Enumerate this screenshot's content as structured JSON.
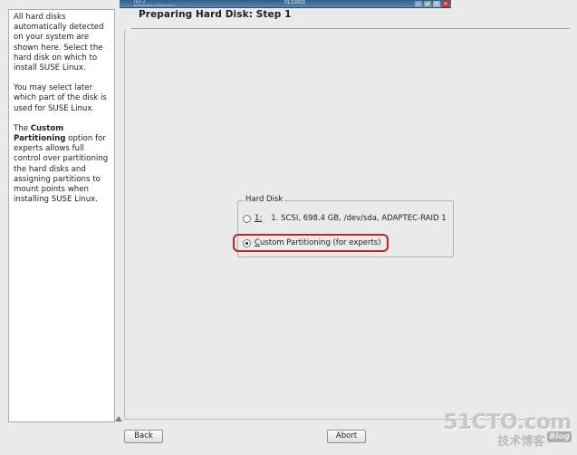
{
  "remote_console": {
    "brand_line": "ILO 2",
    "sub_line": "INTEGRATED LIGHTS-OUT 2",
    "host": "DL320G5",
    "tray_icons": [
      "monitor-icon",
      "network-icon",
      "power-icon",
      "close-icon"
    ]
  },
  "help": {
    "p1": "All hard disks automatically detected on your system are shown here. Select the hard disk on which to install SUSE Linux.",
    "p2": "You may select later which part of the disk is used for SUSE Linux.",
    "p3_pre": "The ",
    "p3_bold": "Custom Partitioning",
    "p3_post": " option for experts allows full control over partitioning the hard disks and assigning partitions to mount points when installing SUSE Linux."
  },
  "page": {
    "title": "Preparing Hard Disk: Step 1"
  },
  "hard_disk": {
    "legend": "Hard Disk",
    "options": [
      {
        "key": "1:",
        "label": "1. SCSI,  698.4 GB, /dev/sda, ADAPTEC-RAID 1",
        "selected": false
      },
      {
        "key": "",
        "label": "Custom Partitioning (for experts)",
        "selected": true
      }
    ]
  },
  "buttons": {
    "back": "Back",
    "abort": "Abort"
  },
  "watermark": {
    "site": "51CTO.com",
    "sub": "技术博客",
    "blog": "Blog"
  }
}
